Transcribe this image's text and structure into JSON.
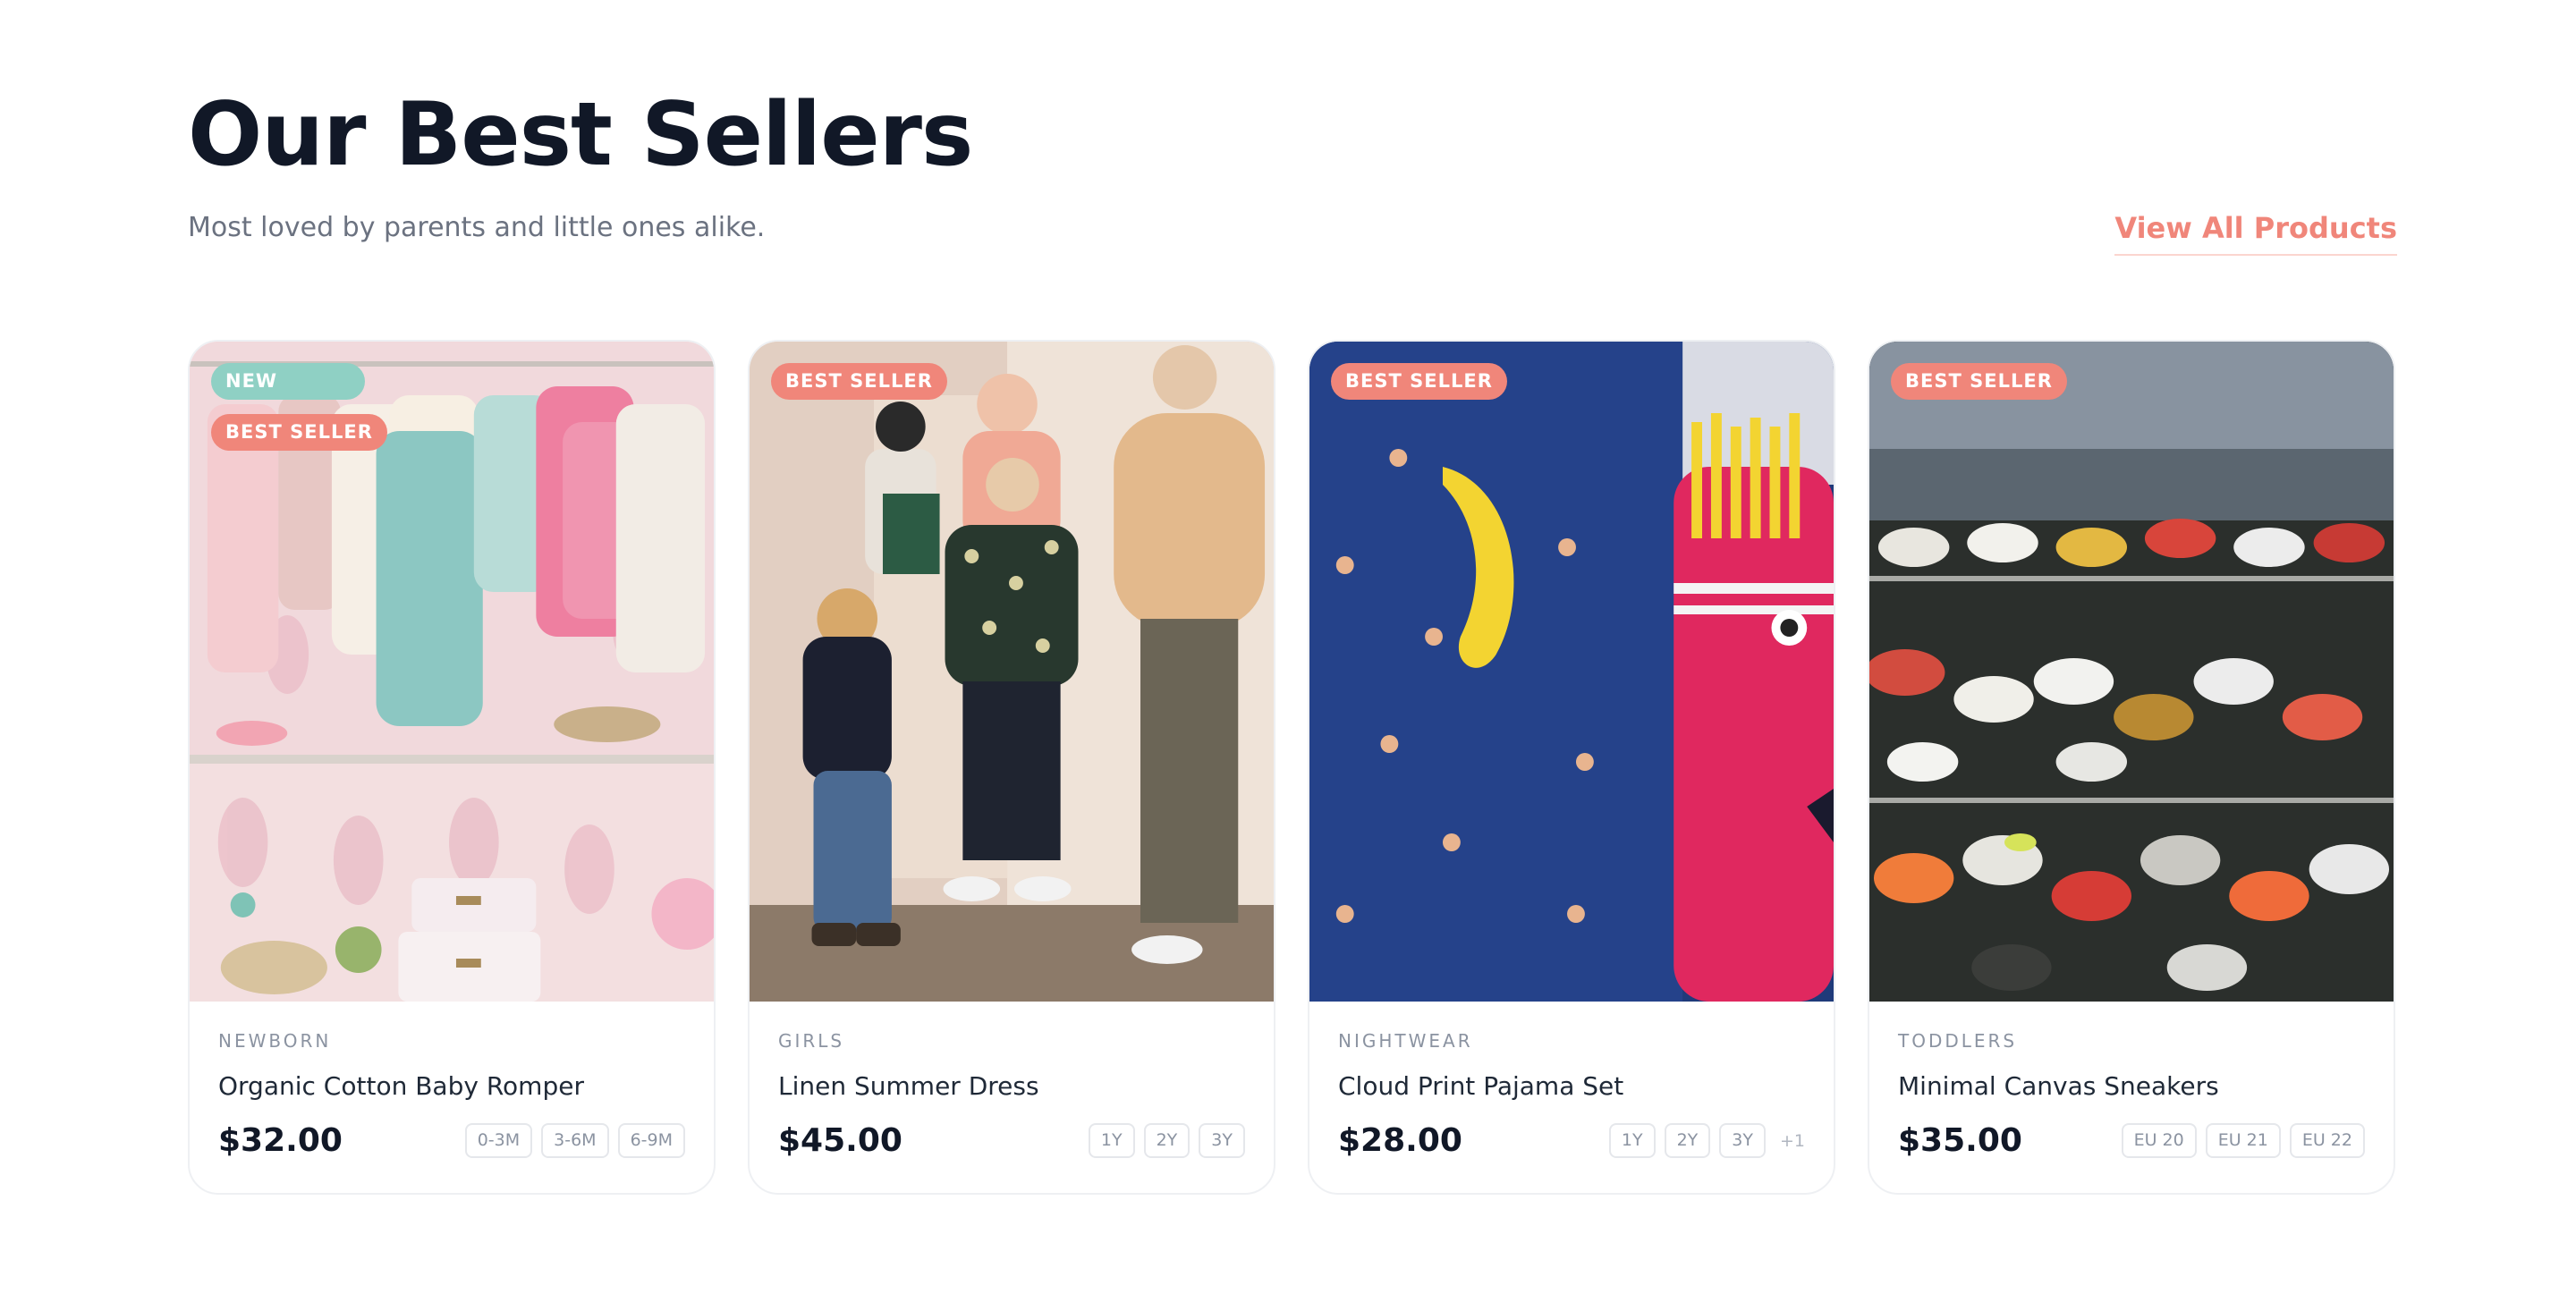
{
  "header": {
    "title": "Our Best Sellers",
    "subtitle": "Most loved by parents and little ones alike.",
    "view_all_label": "View All Products"
  },
  "colors": {
    "accent": "#f0867a",
    "new_badge": "#8fd0c4",
    "text_dark": "#111827",
    "text_muted": "#6b7280"
  },
  "products": [
    {
      "category": "NEWBORN",
      "name": "Organic Cotton Baby Romper",
      "price": "$32.00",
      "badges": [
        "NEW",
        "BEST SELLER"
      ],
      "sizes": [
        "0-3M",
        "3-6M",
        "6-9M"
      ],
      "more": ""
    },
    {
      "category": "GIRLS",
      "name": "Linen Summer Dress",
      "price": "$45.00",
      "badges": [
        "BEST SELLER"
      ],
      "sizes": [
        "1Y",
        "2Y",
        "3Y"
      ],
      "more": ""
    },
    {
      "category": "NIGHTWEAR",
      "name": "Cloud Print Pajama Set",
      "price": "$28.00",
      "badges": [
        "BEST SELLER"
      ],
      "sizes": [
        "1Y",
        "2Y",
        "3Y"
      ],
      "more": "+1"
    },
    {
      "category": "TODDLERS",
      "name": "Minimal Canvas Sneakers",
      "price": "$35.00",
      "badges": [
        "BEST SELLER"
      ],
      "sizes": [
        "EU 20",
        "EU 21",
        "EU 22"
      ],
      "more": ""
    }
  ]
}
